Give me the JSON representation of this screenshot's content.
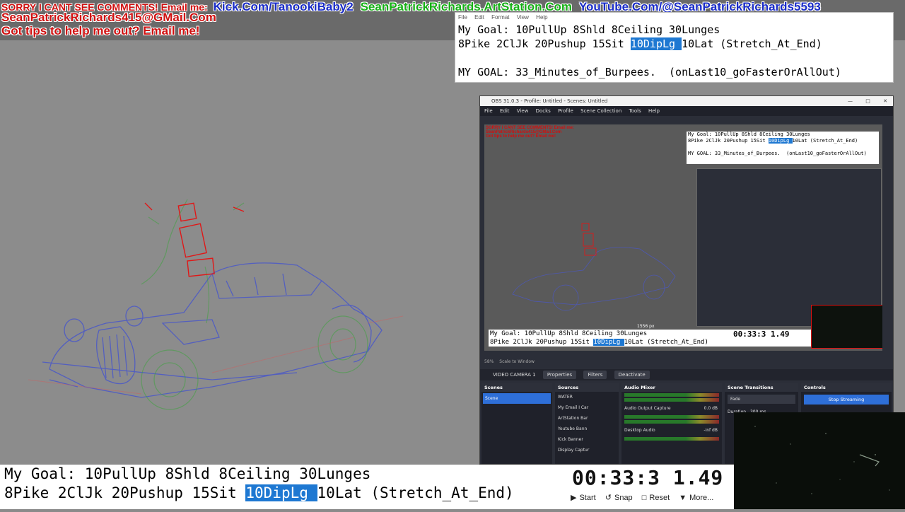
{
  "banner": {
    "line1_red": "SORRY I CANT SEE COMMENTS! Email me:",
    "kick": "Kick.Com/TanookiBaby2",
    "artstation": "SeanPatrickRichards.ArtStation.Com",
    "youtube": "YouTube.Com/@SeanPatrickRichards5593",
    "email": "SeanPatrickRichards415@GMail.Com",
    "tips": "Got tips to help me out? Email me!"
  },
  "notepad": {
    "menu": [
      "File",
      "Edit",
      "Format",
      "View",
      "Help"
    ],
    "line1": "My Goal: 10PullUp 8Shld 8Ceiling 30Lunges",
    "line2_pre": "8Pike 2ClJk 20Pushup 15Sit ",
    "line2_hl": "10DipLg ",
    "line2_post": "10Lat (Stretch_At_End)",
    "line3": "MY GOAL: 33_Minutes_of_Burpees.  (onLast10_goFasterOrAllOut)"
  },
  "obs": {
    "title": "OBS 31.0.3 - Profile: Untitled - Scenes: Untitled",
    "menu": [
      "File",
      "Edit",
      "View",
      "Docks",
      "Profile",
      "Scene Collection",
      "Tools",
      "Help"
    ],
    "preview_size": "1556 px",
    "zoom": "58%",
    "scale_label": "Scale to Window",
    "source_selected": "VIDEO CAMERA 1",
    "properties": "Properties",
    "filters": "Filters",
    "deactivate": "Deactivate",
    "docks": {
      "scenes": {
        "title": "Scenes",
        "items": [
          "Scene"
        ]
      },
      "sources": {
        "title": "Sources",
        "items": [
          "WATER",
          "My Email I Car",
          "ArtStation Bar",
          "Youtube Bann",
          "Kick Banner",
          "Display Captur"
        ]
      },
      "mixer": {
        "title": "Audio Mixer",
        "channels": [
          {
            "name": "Audio Output Capture",
            "level": "0.0 dB"
          },
          {
            "name": "Desktop Audio",
            "level": "-inf dB"
          }
        ]
      },
      "transitions": {
        "title": "Scene Transitions",
        "type": "Fade",
        "duration_label": "Duration",
        "duration": "300 ms"
      },
      "controls": {
        "title": "Controls",
        "stop_streaming": "Stop Streaming"
      }
    }
  },
  "bottom": {
    "line1": "My Goal: 10PullUp 8Shld 8Ceiling 30Lunges",
    "line2_pre": "8Pike 2ClJk 20Pushup 15Sit ",
    "line2_hl": "10DipLg ",
    "line2_post": "10Lat (Stretch_At_End)"
  },
  "timer": {
    "value": "00:33:3 1.49",
    "start": "Start",
    "snap": "Snap",
    "reset": "Reset",
    "more": "More..."
  },
  "colors": {
    "highlight": "#1e78d2",
    "banner_red": "#d01010",
    "banner_blue": "#1a2cc8",
    "banner_green": "#16b016",
    "obs_blue": "#2e6fd8"
  }
}
